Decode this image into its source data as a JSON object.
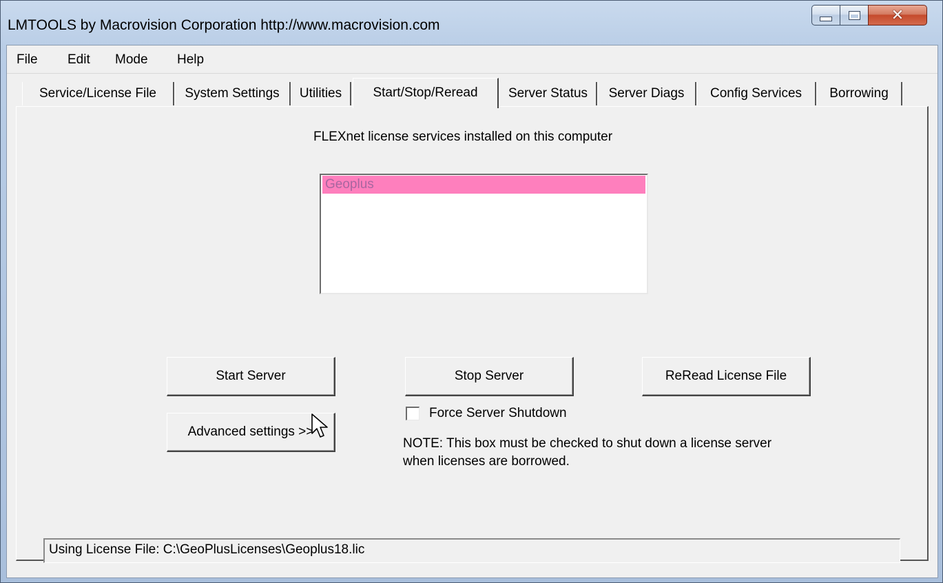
{
  "window": {
    "title": "LMTOOLS by Macrovision Corporation http://www.macrovision.com",
    "caption_buttons": {
      "minimize": "minimize-icon",
      "maximize": "maximize-icon",
      "close": "close-icon"
    }
  },
  "menu": [
    "File",
    "Edit",
    "Mode",
    "Help"
  ],
  "tabs": [
    "Service/License File",
    "System Settings",
    "Utilities",
    "Start/Stop/Reread",
    "Server Status",
    "Server Diags",
    "Config Services",
    "Borrowing"
  ],
  "active_tab": "Start/Stop/Reread",
  "panel": {
    "services_label": "FLEXnet license services installed on this computer",
    "services": [
      {
        "name": "Geoplus",
        "selected": true
      }
    ],
    "selection_color": "#fe7fbd",
    "buttons": {
      "start": "Start Server",
      "stop": "Stop Server",
      "reread": "ReRead License File",
      "advanced": "Advanced settings >>"
    },
    "force_shutdown": {
      "label": "Force Server Shutdown",
      "checked": false
    },
    "note_line1": "NOTE:  This box must be checked to shut down a license server",
    "note_line2": "when licenses are borrowed."
  },
  "status_bar": {
    "text": "Using License File:  C:\\GeoPlusLicenses\\Geoplus18.lic"
  }
}
